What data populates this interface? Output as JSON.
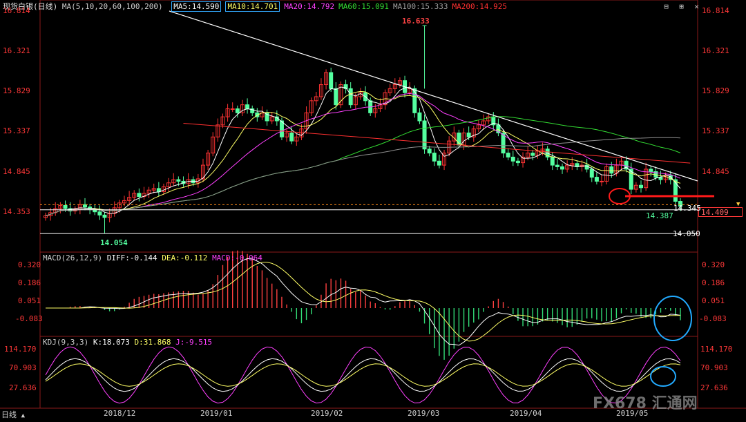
{
  "header": {
    "title": "现货白银(日线)",
    "ma_label": "MA(5,10,20,60,100,200)",
    "ma_values": [
      {
        "text": "MA5:14.590",
        "color": "#ffffff",
        "boxed": true
      },
      {
        "text": "MA10:14.701",
        "color": "#ffff66",
        "boxed": true
      },
      {
        "text": "MA20:14.792",
        "color": "#ff40ff",
        "boxed": false
      },
      {
        "text": "MA60:15.091",
        "color": "#33dd33",
        "boxed": false
      },
      {
        "text": "MA100:15.333",
        "color": "#a0a0a0",
        "boxed": false
      },
      {
        "text": "MA200:14.925",
        "color": "#ff3030",
        "boxed": false
      }
    ],
    "window_controls": [
      "⊟",
      "⊞",
      "✕"
    ]
  },
  "colors": {
    "up": "#ff3333",
    "down": "#54ffa0",
    "bg": "#000000",
    "axis": "#ff3838",
    "frame": "#8c1a1a"
  },
  "price_axis": {
    "ticks": [
      "16.814",
      "16.321",
      "15.829",
      "15.337",
      "14.845",
      "14.353"
    ],
    "current": "14.409",
    "range": [
      14.0,
      16.814
    ]
  },
  "annotations": {
    "high": "16.633",
    "low": "14.054",
    "support_level": "14.050",
    "support_label": "14.345",
    "last_low": "14.387"
  },
  "macd": {
    "label": "MACD(26,12,9)",
    "diff": "DIFF:-0.144",
    "dea": "DEA:-0.112",
    "macd": "MACD:-0.064",
    "ticks": [
      "0.320",
      "0.186",
      "0.051",
      "-0.083"
    ]
  },
  "kdj": {
    "label": "KDJ(9,3,3)",
    "k": "K:18.073",
    "d": "D:31.868",
    "j": "J:-9.515",
    "ticks": [
      "114.170",
      "70.903",
      "27.636"
    ]
  },
  "x_axis": {
    "labels": [
      "2018/12",
      "2019/01",
      "2019/02",
      "2019/03",
      "2019/04",
      "2019/05"
    ]
  },
  "footer": {
    "period_label": "日线",
    "watermark": "FX678 汇通网"
  },
  "chart_data": {
    "type": "candlestick",
    "title": "现货白银(日线)",
    "xlabel": "",
    "ylabel": "",
    "ylim": [
      14.0,
      16.814
    ],
    "x": [
      "2018/12",
      "2019/01",
      "2019/02",
      "2019/03",
      "2019/04",
      "2019/05"
    ],
    "series": [
      {
        "name": "MA5",
        "values": [
          14.59
        ]
      },
      {
        "name": "MA10",
        "values": [
          14.701
        ]
      },
      {
        "name": "MA20",
        "values": [
          14.792
        ]
      },
      {
        "name": "MA60",
        "values": [
          15.091
        ]
      },
      {
        "name": "MA100",
        "values": [
          15.333
        ]
      },
      {
        "name": "MA200",
        "values": [
          14.925
        ]
      }
    ],
    "close": [
      14.27,
      14.31,
      14.36,
      14.4,
      14.36,
      14.33,
      14.35,
      14.41,
      14.38,
      14.35,
      14.32,
      14.28,
      14.25,
      14.3,
      14.37,
      14.43,
      14.46,
      14.5,
      14.55,
      14.51,
      14.55,
      14.59,
      14.61,
      14.57,
      14.63,
      14.68,
      14.72,
      14.7,
      14.67,
      14.72,
      14.68,
      14.73,
      14.9,
      15.05,
      15.25,
      15.4,
      15.5,
      15.6,
      15.6,
      15.55,
      15.65,
      15.6,
      15.55,
      15.5,
      15.55,
      15.45,
      15.5,
      15.45,
      15.25,
      15.3,
      15.2,
      15.25,
      15.35,
      15.55,
      15.7,
      15.75,
      15.9,
      16.05,
      15.85,
      15.65,
      15.9,
      15.85,
      15.65,
      15.75,
      15.8,
      15.7,
      15.55,
      15.6,
      15.65,
      15.8,
      15.85,
      15.9,
      15.95,
      15.8,
      15.85,
      15.55,
      15.45,
      15.1,
      15.05,
      14.95,
      14.9,
      15.05,
      15.2,
      15.3,
      15.15,
      15.3,
      15.25,
      15.35,
      15.4,
      15.45,
      15.5,
      15.4,
      15.3,
      15.05,
      15.0,
      14.95,
      14.93,
      15.0,
      15.05,
      15.02,
      15.08,
      15.1,
      15.0,
      14.9,
      14.88,
      14.85,
      14.9,
      14.92,
      14.88,
      14.9,
      14.85,
      14.75,
      14.7,
      14.7,
      14.88,
      14.8,
      14.9,
      14.95,
      14.85,
      14.6,
      14.65,
      14.62,
      14.85,
      14.82,
      14.75,
      14.72,
      14.77,
      14.72,
      14.45,
      14.39
    ]
  }
}
